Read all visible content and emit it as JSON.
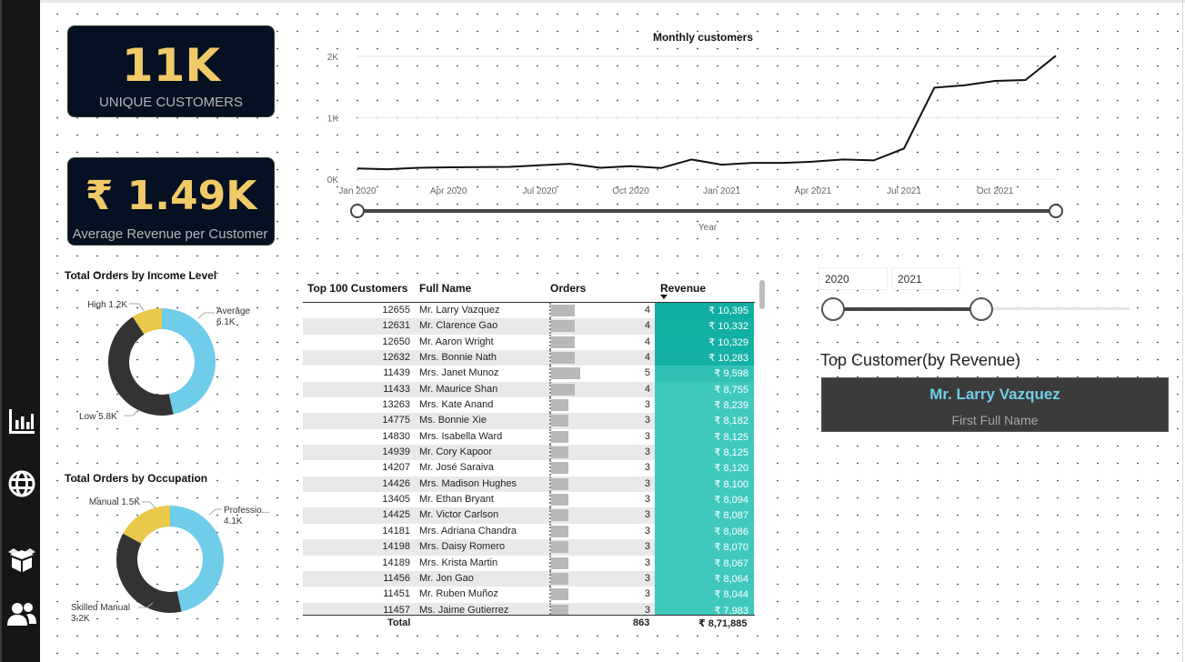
{
  "sidebar": {
    "icons": [
      "bar-chart-icon",
      "globe-icon",
      "box-icon",
      "users-icon"
    ]
  },
  "kpis": {
    "unique_customers": {
      "value": "11K",
      "label": "UNIQUE CUSTOMERS"
    },
    "avg_revenue": {
      "value": "₹ 1.49K",
      "label": "Average Revenue per Customer"
    }
  },
  "line_chart": {
    "title": "Monthly customers",
    "xlabel": "Year",
    "y_ticks": [
      "2K",
      "1K",
      "0K"
    ],
    "x_ticks": [
      "Jan 2020",
      "Apr 2020",
      "Jul 2020",
      "Oct 2020",
      "Jan 2021",
      "Apr 2021",
      "Jul 2021",
      "Oct 2021"
    ]
  },
  "chart_data": [
    {
      "type": "line",
      "title": "Monthly customers",
      "xlabel": "Year",
      "ylabel": "",
      "ylim": [
        0,
        2000
      ],
      "x": [
        "Jan 2020",
        "Feb 2020",
        "Mar 2020",
        "Apr 2020",
        "May 2020",
        "Jun 2020",
        "Jul 2020",
        "Aug 2020",
        "Sep 2020",
        "Oct 2020",
        "Nov 2020",
        "Dec 2020",
        "Jan 2021",
        "Feb 2021",
        "Mar 2021",
        "Apr 2021",
        "May 2021",
        "Jun 2021",
        "Jul 2021",
        "Aug 2021",
        "Sep 2021",
        "Oct 2021",
        "Nov 2021",
        "Dec 2021"
      ],
      "series": [
        {
          "values": [
            175,
            162,
            185,
            192,
            195,
            200,
            225,
            250,
            185,
            210,
            180,
            320,
            235,
            265,
            265,
            285,
            320,
            305,
            500,
            1490,
            1530,
            1600,
            1615,
            2010
          ]
        }
      ]
    },
    {
      "type": "pie",
      "title": "Total Orders by Income Level",
      "labels": [
        "High",
        "Average",
        "Low"
      ],
      "values": [
        1.2,
        6.1,
        5.8
      ],
      "value_labels": [
        "1.2K",
        "6.1K",
        "5.8K"
      ],
      "colors": [
        "#e9c84a",
        "#6fcdea",
        "#333333"
      ]
    },
    {
      "type": "pie",
      "title": "Total Orders by Occupation",
      "labels": [
        "Manual",
        "Professio...",
        "Skilled Manual"
      ],
      "values": [
        1.5,
        4.1,
        3.2
      ],
      "value_labels": [
        "1.5K",
        "4.1K",
        "3.2K"
      ],
      "colors": [
        "#e9c84a",
        "#6fcdea",
        "#333333"
      ]
    }
  ],
  "income_donut": {
    "title": "Total Orders by Income Level"
  },
  "occupation_donut": {
    "title": "Total Orders by Occupation"
  },
  "table": {
    "headers": {
      "top100": "Top 100 Customers",
      "name": "Full Name",
      "orders": "Orders",
      "revenue": "Revenue"
    },
    "rows": [
      {
        "id": "12655",
        "name": "Mr. Larry Vazquez",
        "orders": 4,
        "revenue": "₹ 10,395",
        "rev_value": 10395
      },
      {
        "id": "12631",
        "name": "Mr. Clarence Gao",
        "orders": 4,
        "revenue": "₹ 10,332",
        "rev_value": 10332
      },
      {
        "id": "12650",
        "name": "Mr. Aaron Wright",
        "orders": 4,
        "revenue": "₹ 10,329",
        "rev_value": 10329
      },
      {
        "id": "12632",
        "name": "Mrs. Bonnie Nath",
        "orders": 4,
        "revenue": "₹ 10,283",
        "rev_value": 10283
      },
      {
        "id": "11439",
        "name": "Mrs. Janet Munoz",
        "orders": 5,
        "revenue": "₹ 9,598",
        "rev_value": 9598
      },
      {
        "id": "11433",
        "name": "Mr. Maurice Shan",
        "orders": 4,
        "revenue": "₹ 8,755",
        "rev_value": 8755
      },
      {
        "id": "13263",
        "name": "Mrs. Kate Anand",
        "orders": 3,
        "revenue": "₹ 8,239",
        "rev_value": 8239
      },
      {
        "id": "14775",
        "name": "Ms. Bonnie Xie",
        "orders": 3,
        "revenue": "₹ 8,182",
        "rev_value": 8182
      },
      {
        "id": "14830",
        "name": "Mrs. Isabella Ward",
        "orders": 3,
        "revenue": "₹ 8,125",
        "rev_value": 8125
      },
      {
        "id": "14939",
        "name": "Mr. Cory Kapoor",
        "orders": 3,
        "revenue": "₹ 8,125",
        "rev_value": 8125
      },
      {
        "id": "14207",
        "name": "Mr. José Saraiva",
        "orders": 3,
        "revenue": "₹ 8,120",
        "rev_value": 8120
      },
      {
        "id": "14426",
        "name": "Mrs. Madison Hughes",
        "orders": 3,
        "revenue": "₹ 8,100",
        "rev_value": 8100
      },
      {
        "id": "13405",
        "name": "Mr. Ethan Bryant",
        "orders": 3,
        "revenue": "₹ 8,094",
        "rev_value": 8094
      },
      {
        "id": "14425",
        "name": "Mr. Victor Carlson",
        "orders": 3,
        "revenue": "₹ 8,087",
        "rev_value": 8087
      },
      {
        "id": "14181",
        "name": "Mrs. Adriana Chandra",
        "orders": 3,
        "revenue": "₹ 8,086",
        "rev_value": 8086
      },
      {
        "id": "14198",
        "name": "Mrs. Daisy Romero",
        "orders": 3,
        "revenue": "₹ 8,070",
        "rev_value": 8070
      },
      {
        "id": "14189",
        "name": "Mrs. Krista Martin",
        "orders": 3,
        "revenue": "₹ 8,067",
        "rev_value": 8067
      },
      {
        "id": "11456",
        "name": "Mr. Jon Gao",
        "orders": 3,
        "revenue": "₹ 8,064",
        "rev_value": 8064
      },
      {
        "id": "11451",
        "name": "Mr. Ruben Muñoz",
        "orders": 3,
        "revenue": "₹ 8,044",
        "rev_value": 8044
      },
      {
        "id": "11457",
        "name": "Ms. Jaime Gutierrez",
        "orders": 3,
        "revenue": "₹ 7,983",
        "rev_value": 7983
      }
    ],
    "total": {
      "label": "Total",
      "orders": "863",
      "revenue": "₹ 8,71,885"
    }
  },
  "year_slicer": {
    "start": "2020",
    "end": "2021",
    "position": 0.5
  },
  "top_customer": {
    "title": "Top Customer(by Revenue)",
    "name": "Mr. Larry Vazquez",
    "label": "First Full Name"
  },
  "colors": {
    "kpi_value": "#efca67",
    "donut_yellow": "#e9c84a",
    "donut_blue": "#6fcdea",
    "donut_dark": "#333333",
    "revenue_high": "#10aea3",
    "revenue_low": "#3fc9bc"
  }
}
